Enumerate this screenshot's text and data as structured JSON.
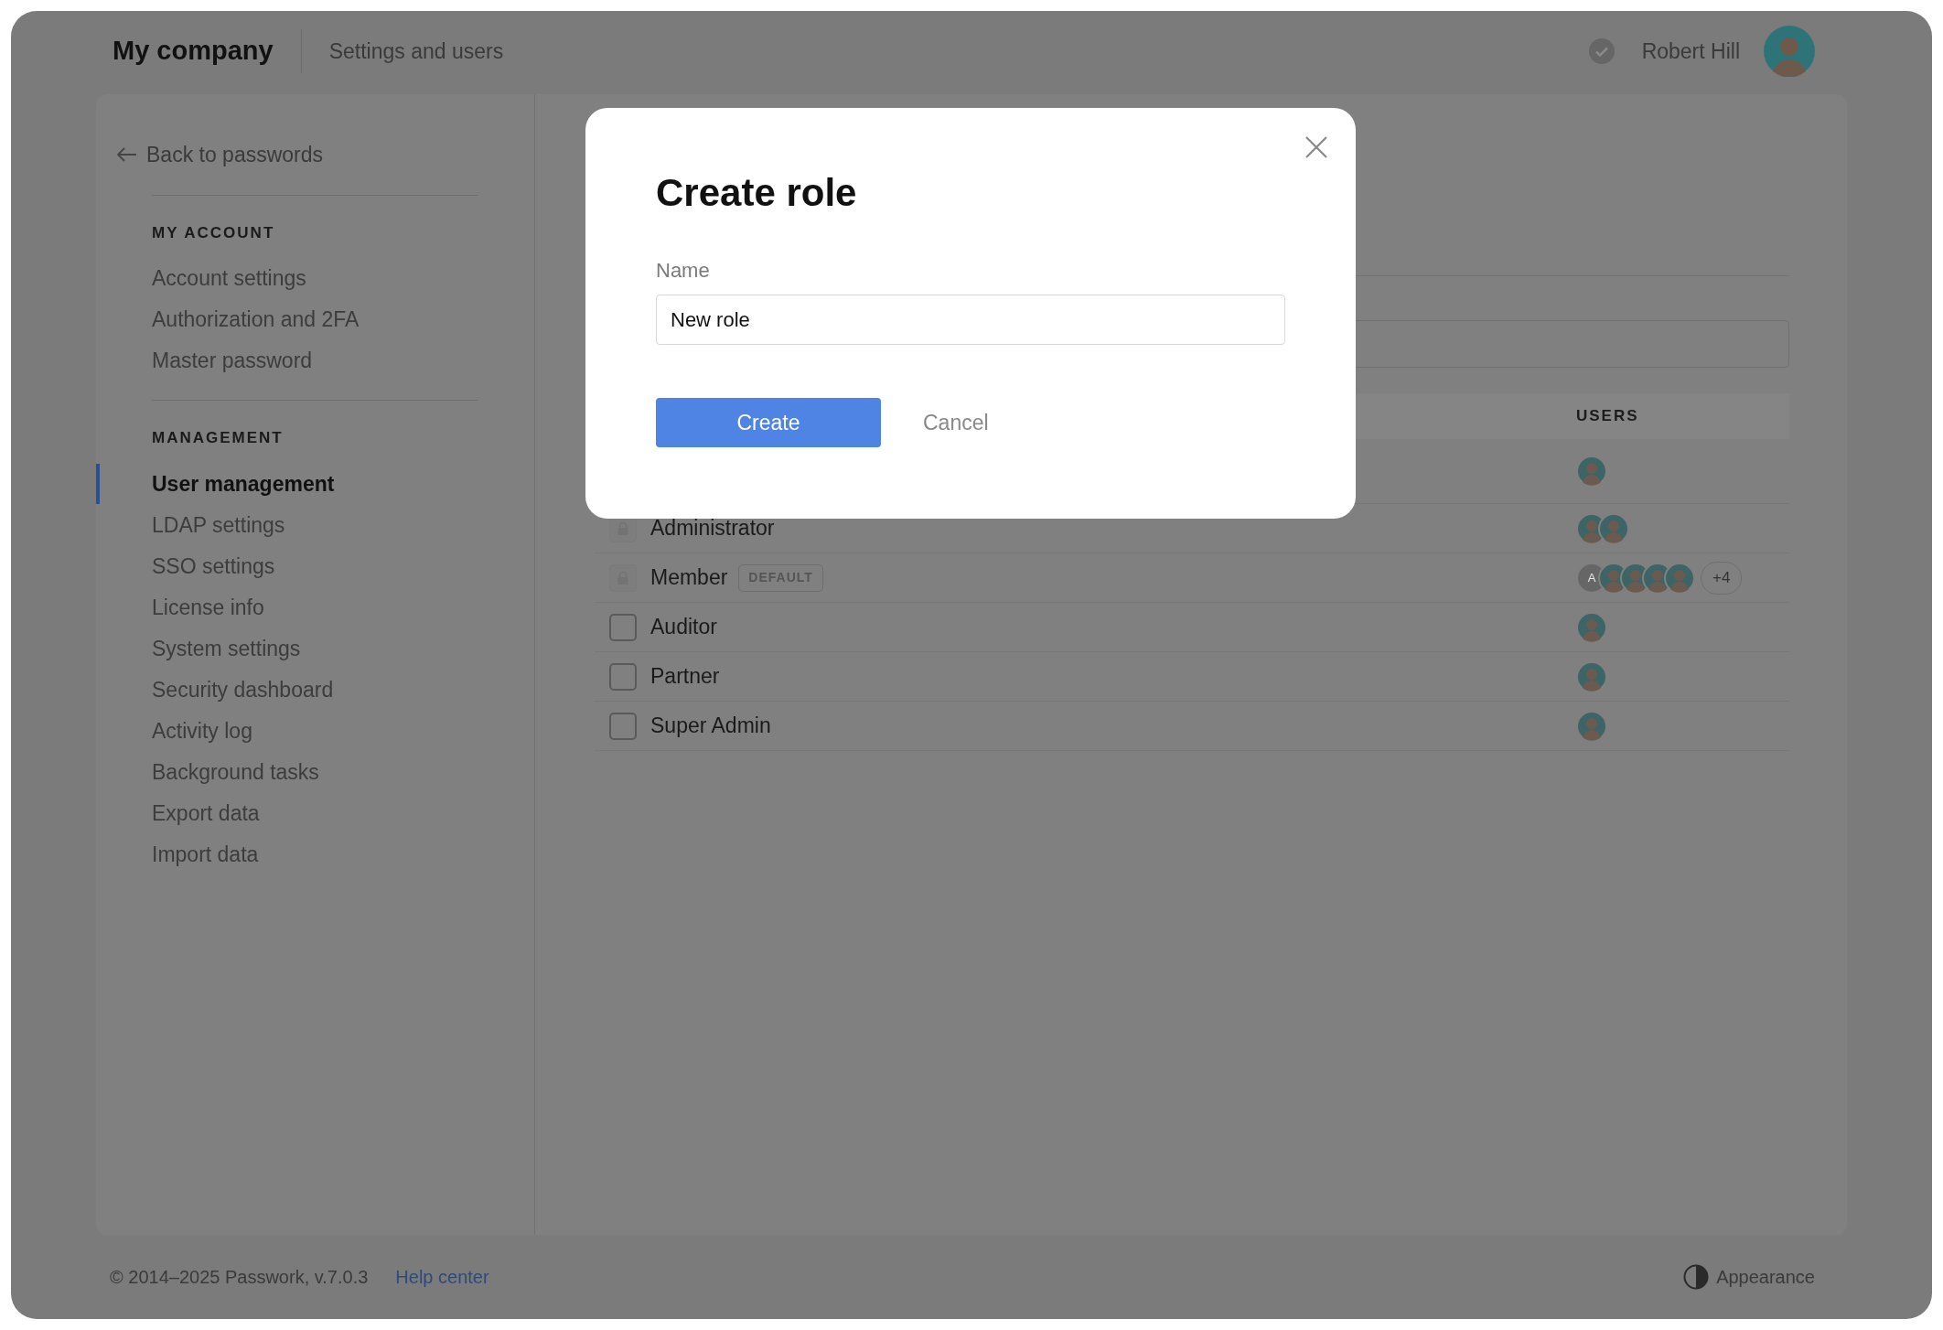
{
  "header": {
    "company": "My company",
    "section": "Settings and users",
    "user_name": "Robert Hill"
  },
  "sidebar": {
    "back_link": "Back to passwords",
    "groups": [
      {
        "title": "MY ACCOUNT",
        "items": [
          {
            "label": "Account settings",
            "selected": false
          },
          {
            "label": "Authorization and 2FA",
            "selected": false
          },
          {
            "label": "Master password",
            "selected": false
          }
        ]
      },
      {
        "title": "MANAGEMENT",
        "items": [
          {
            "label": "User management",
            "selected": true
          },
          {
            "label": "LDAP settings",
            "selected": false
          },
          {
            "label": "SSO settings",
            "selected": false
          },
          {
            "label": "License info",
            "selected": false
          },
          {
            "label": "System settings",
            "selected": false
          },
          {
            "label": "Security dashboard",
            "selected": false
          },
          {
            "label": "Activity log",
            "selected": false
          },
          {
            "label": "Background tasks",
            "selected": false
          },
          {
            "label": "Export data",
            "selected": false
          },
          {
            "label": "Import data",
            "selected": false
          }
        ]
      }
    ]
  },
  "roles_table": {
    "users_column": "USERS",
    "rows": [
      {
        "avatars": [
          {
            "kind": "photo"
          }
        ]
      },
      {
        "kind": "locked",
        "name": "Administrator",
        "avatars": [
          {
            "kind": "photo"
          },
          {
            "kind": "photo"
          }
        ]
      },
      {
        "kind": "locked",
        "name": "Member",
        "badge": "DEFAULT",
        "avatars": [
          {
            "kind": "letter",
            "letter": "A"
          },
          {
            "kind": "photo"
          },
          {
            "kind": "photo"
          },
          {
            "kind": "photo"
          },
          {
            "kind": "photo"
          }
        ],
        "more": "+4"
      },
      {
        "kind": "checkbox",
        "checked": false,
        "name": "Auditor",
        "avatars": [
          {
            "kind": "photo"
          }
        ]
      },
      {
        "kind": "checkbox",
        "checked": false,
        "name": "Partner",
        "avatars": [
          {
            "kind": "photo"
          }
        ]
      },
      {
        "kind": "checkbox",
        "checked": false,
        "name": "Super Admin",
        "avatars": [
          {
            "kind": "photo"
          }
        ]
      }
    ]
  },
  "modal": {
    "title": "Create role",
    "field_label": "Name",
    "field_value": "New role",
    "buttons": [
      {
        "kind": "primary",
        "label": "Create"
      },
      {
        "kind": "link",
        "label": "Cancel"
      }
    ]
  },
  "footer": {
    "copyright": "© 2014–2025 Passwork, v.7.0.3",
    "help_link": "Help center",
    "appearance": "Appearance"
  }
}
